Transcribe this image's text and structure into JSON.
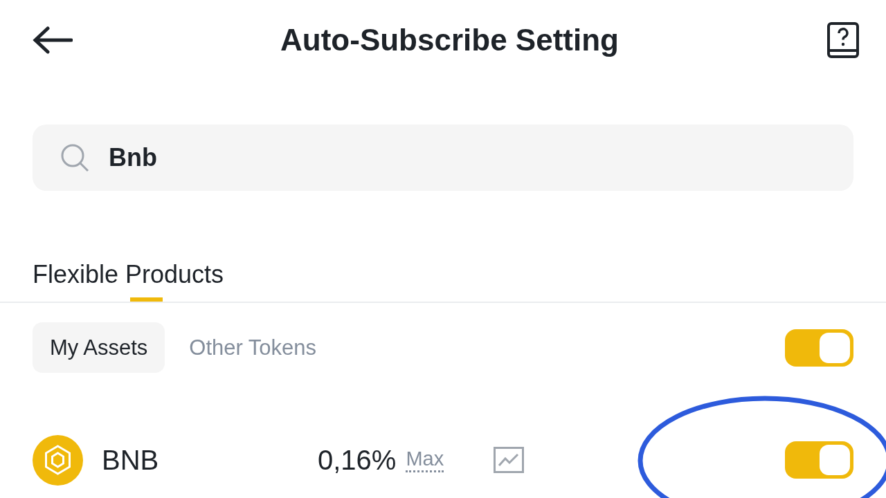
{
  "header": {
    "title": "Auto-Subscribe Setting"
  },
  "search": {
    "value": "Bnb"
  },
  "product_tabs": [
    {
      "label": "Flexible Products",
      "selected": true
    }
  ],
  "filter_tabs": [
    {
      "label": "My Assets",
      "selected": true
    },
    {
      "label": "Other Tokens",
      "selected": false
    }
  ],
  "all_toggle": {
    "on": true
  },
  "assets": [
    {
      "symbol": "BNB",
      "apy": "0,16%",
      "apy_label": "Max",
      "on": true
    }
  ]
}
